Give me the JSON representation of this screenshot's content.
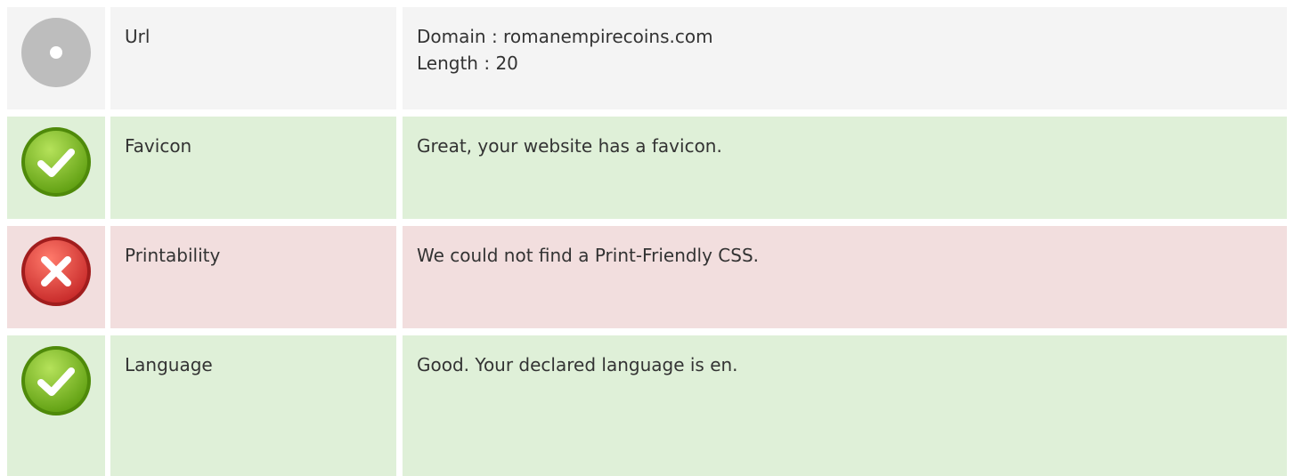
{
  "rows": [
    {
      "label": "Url",
      "status": "neutral",
      "icon": "neutral-circle-icon",
      "lines": [
        "Domain : romanempirecoins.com",
        "Length : 20"
      ]
    },
    {
      "label": "Favicon",
      "status": "good",
      "icon": "check-circle-icon",
      "lines": [
        "Great, your website has a favicon."
      ]
    },
    {
      "label": "Printability",
      "status": "bad",
      "icon": "cross-circle-icon",
      "lines": [
        "We could not find a Print-Friendly CSS."
      ]
    },
    {
      "label": "Language",
      "status": "good",
      "icon": "check-circle-icon",
      "lines": [
        "Good. Your declared language is en."
      ]
    }
  ],
  "colors": {
    "neutral_bg": "#f4f4f4",
    "good_bg": "#dff0d8",
    "bad_bg": "#f2dede",
    "good_icon": "#7cbf1c",
    "bad_icon": "#e53935",
    "neutral_icon": "#bdbdbd"
  }
}
